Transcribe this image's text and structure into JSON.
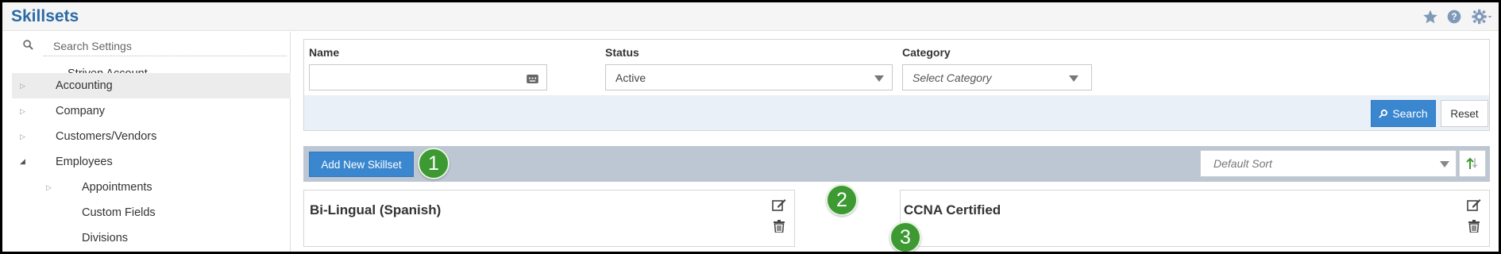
{
  "header": {
    "title": "Skillsets",
    "icons": [
      "star-icon",
      "help-icon",
      "gear-icon"
    ]
  },
  "sidebar": {
    "search_placeholder": "Search Settings",
    "items": [
      {
        "label": "Striven Account",
        "arrow": ""
      },
      {
        "label": "Accounting",
        "arrow": "collapsed",
        "active": true
      },
      {
        "label": "Company",
        "arrow": "collapsed"
      },
      {
        "label": "Customers/Vendors",
        "arrow": "collapsed"
      },
      {
        "label": "Employees",
        "arrow": "expanded"
      },
      {
        "label": "Appointments",
        "arrow": "collapsed"
      },
      {
        "label": "Custom Fields",
        "arrow": ""
      },
      {
        "label": "Divisions",
        "arrow": ""
      }
    ]
  },
  "filters": {
    "name_label": "Name",
    "name_value": "",
    "status_label": "Status",
    "status_value": "Active",
    "category_label": "Category",
    "category_value": "Select Category",
    "search_button": "Search",
    "reset_button": "Reset"
  },
  "toolbar": {
    "add_button": "Add New Skillset",
    "sort_value": "Default Sort"
  },
  "cards": [
    {
      "title": "Bi-Lingual (Spanish)"
    },
    {
      "title": "CCNA Certified"
    }
  ],
  "callouts": [
    "1",
    "2",
    "3"
  ],
  "colors": {
    "title": "#2b6aa6",
    "primary_button": "#3a87cf",
    "toolbar_bg": "#bcc7d3",
    "filter_bar_bg": "#eaf0f8",
    "callout": "#3d9a33"
  }
}
